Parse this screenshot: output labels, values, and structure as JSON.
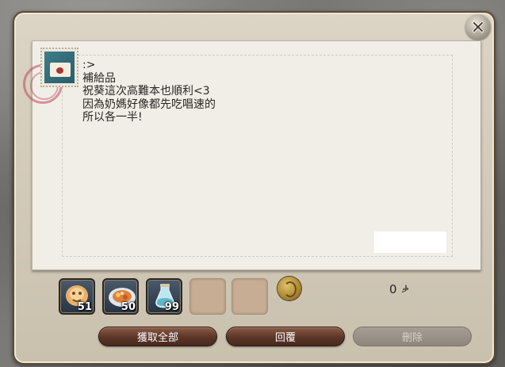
{
  "letter": {
    "lines": [
      ":>",
      "補給品",
      "祝葵這次高難本也順利<3",
      "因為奶媽好像都先吃唱速的",
      "所以各一半!"
    ]
  },
  "attachments": [
    {
      "icon": "food-item-icon",
      "quantity": "51"
    },
    {
      "icon": "dish-item-icon",
      "quantity": "50"
    },
    {
      "icon": "potion-item-icon",
      "quantity": "99"
    },
    {
      "icon": "",
      "quantity": ""
    },
    {
      "icon": "",
      "quantity": ""
    }
  ],
  "gil": {
    "icon": "gil-coin-icon",
    "amount": "0",
    "unit": "ቃ"
  },
  "buttons": {
    "take_all": "獲取全部",
    "reply": "回覆",
    "delete": "刪除"
  },
  "colors": {
    "button_active": "#5b3527",
    "button_disabled": "#8f877d",
    "paper": "#f1eee8"
  }
}
